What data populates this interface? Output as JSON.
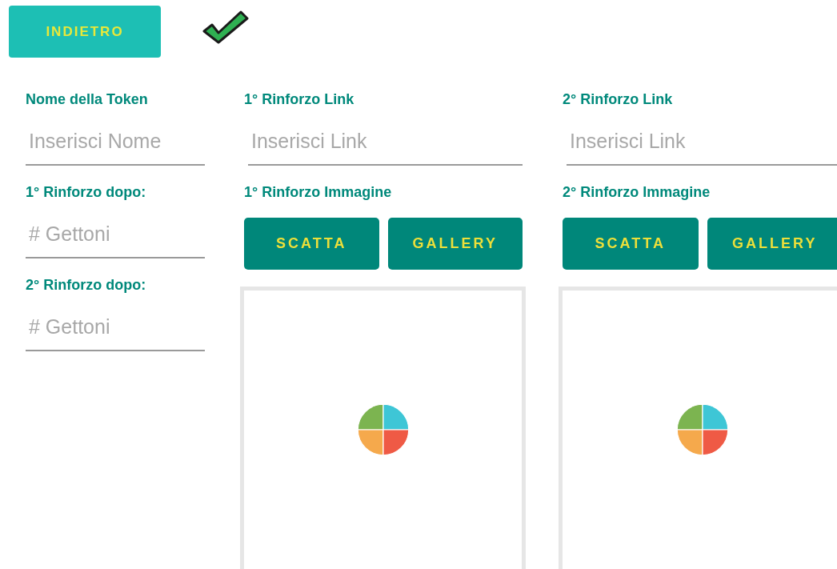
{
  "back_button": {
    "label": "INDIETRO"
  },
  "left_fields": [
    {
      "label": "Nome della Token",
      "placeholder": "Inserisci Nome"
    },
    {
      "label": "1° Rinforzo dopo:",
      "placeholder": "# Gettoni"
    },
    {
      "label": "2° Rinforzo dopo:",
      "placeholder": "# Gettoni"
    }
  ],
  "reinforcements": [
    {
      "link_label": "1° Rinforzo Link",
      "link_placeholder": "Inserisci Link",
      "image_label": "1° Rinforzo Immagine",
      "buttons": [
        "SCATTA",
        "GALLERY"
      ]
    },
    {
      "link_label": "2° Rinforzo Link",
      "link_placeholder": "Inserisci Link",
      "image_label": "2° Rinforzo Immagine",
      "buttons": [
        "SCATTA",
        "GALLERY"
      ]
    }
  ]
}
